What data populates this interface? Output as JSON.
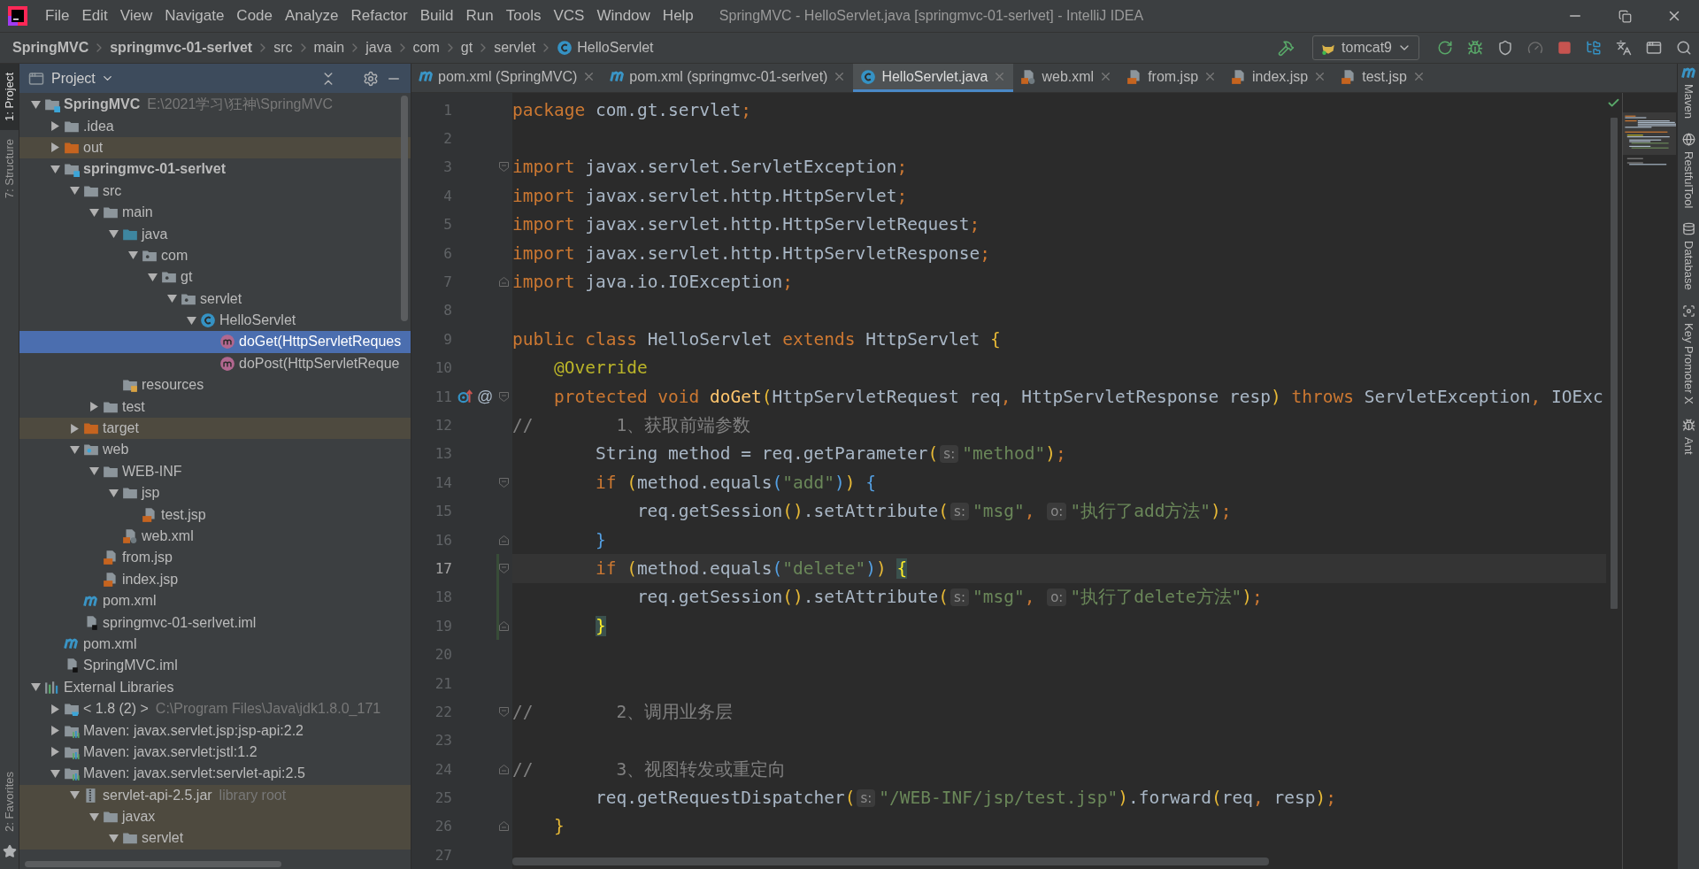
{
  "window": {
    "title": "SpringMVC - HelloServlet.java [springmvc-01-serlvet] - IntelliJ IDEA"
  },
  "menu": [
    "File",
    "Edit",
    "View",
    "Navigate",
    "Code",
    "Analyze",
    "Refactor",
    "Build",
    "Run",
    "Tools",
    "VCS",
    "Window",
    "Help"
  ],
  "breadcrumbs": [
    {
      "label": "SpringMVC",
      "bold": true,
      "kind": "plain"
    },
    {
      "label": "springmvc-01-serlvet",
      "bold": true,
      "kind": "plain"
    },
    {
      "label": "src",
      "bold": false,
      "kind": "plain"
    },
    {
      "label": "main",
      "bold": false,
      "kind": "plain"
    },
    {
      "label": "java",
      "bold": false,
      "kind": "plain"
    },
    {
      "label": "com",
      "bold": false,
      "kind": "plain"
    },
    {
      "label": "gt",
      "bold": false,
      "kind": "plain"
    },
    {
      "label": "servlet",
      "bold": false,
      "kind": "plain"
    },
    {
      "label": "HelloServlet",
      "bold": false,
      "kind": "class"
    }
  ],
  "run_config": {
    "label": "tomcat9"
  },
  "left_tool_tabs": {
    "top": [
      {
        "label": "1: Project",
        "selected": true
      },
      {
        "label": "7: Structure",
        "selected": false
      }
    ],
    "bottom": [
      {
        "label": "2: Favorites",
        "selected": false
      }
    ]
  },
  "project": {
    "title": "Project",
    "tree": [
      {
        "label": "SpringMVC",
        "detail": "E:\\2021学习\\狂神\\SpringMVC",
        "kind": "module",
        "bold": true,
        "expanded": true,
        "selected": false,
        "excluded": false,
        "children": [
          {
            "label": ".idea",
            "kind": "folder",
            "bold": false,
            "expanded": false,
            "selected": false,
            "excluded": false
          },
          {
            "label": "out",
            "kind": "excluded",
            "bold": false,
            "expanded": false,
            "selected": false,
            "excluded": true
          },
          {
            "label": "springmvc-01-serlvet",
            "kind": "module",
            "bold": true,
            "expanded": true,
            "selected": false,
            "excluded": false,
            "children": [
              {
                "label": "src",
                "kind": "folder",
                "bold": false,
                "expanded": true,
                "selected": false,
                "excluded": false,
                "children": [
                  {
                    "label": "main",
                    "kind": "folder",
                    "bold": false,
                    "expanded": true,
                    "selected": false,
                    "excluded": false,
                    "children": [
                      {
                        "label": "java",
                        "kind": "source",
                        "bold": false,
                        "expanded": true,
                        "selected": false,
                        "excluded": false,
                        "children": [
                          {
                            "label": "com",
                            "kind": "package",
                            "bold": false,
                            "expanded": true,
                            "selected": false,
                            "excluded": false,
                            "children": [
                              {
                                "label": "gt",
                                "kind": "package",
                                "bold": false,
                                "expanded": true,
                                "selected": false,
                                "excluded": false,
                                "children": [
                                  {
                                    "label": "servlet",
                                    "kind": "package",
                                    "bold": false,
                                    "expanded": true,
                                    "selected": false,
                                    "excluded": false,
                                    "children": [
                                      {
                                        "label": "HelloServlet",
                                        "kind": "class",
                                        "bold": false,
                                        "expanded": true,
                                        "selected": false,
                                        "excluded": false,
                                        "children": [
                                          {
                                            "label": "doGet(HttpServletReques",
                                            "kind": "method",
                                            "bold": false,
                                            "selected": true,
                                            "excluded": false
                                          },
                                          {
                                            "label": "doPost(HttpServletReque",
                                            "kind": "method",
                                            "bold": false,
                                            "selected": false,
                                            "excluded": false
                                          }
                                        ]
                                      }
                                    ]
                                  }
                                ]
                              }
                            ]
                          }
                        ]
                      },
                      {
                        "label": "resources",
                        "kind": "resources",
                        "bold": false,
                        "selected": false,
                        "excluded": false
                      }
                    ]
                  },
                  {
                    "label": "test",
                    "kind": "folder",
                    "bold": false,
                    "expanded": false,
                    "selected": false,
                    "excluded": false
                  }
                ]
              },
              {
                "label": "target",
                "kind": "excluded",
                "bold": false,
                "expanded": false,
                "selected": false,
                "excluded": true
              },
              {
                "label": "web",
                "kind": "web",
                "bold": false,
                "expanded": true,
                "selected": false,
                "excluded": false,
                "children": [
                  {
                    "label": "WEB-INF",
                    "kind": "folder",
                    "bold": false,
                    "expanded": true,
                    "selected": false,
                    "excluded": false,
                    "children": [
                      {
                        "label": "jsp",
                        "kind": "folder",
                        "bold": false,
                        "expanded": true,
                        "selected": false,
                        "excluded": false,
                        "children": [
                          {
                            "label": "test.jsp",
                            "kind": "jsp",
                            "bold": false,
                            "selected": false,
                            "excluded": false
                          }
                        ]
                      },
                      {
                        "label": "web.xml",
                        "kind": "xml",
                        "bold": false,
                        "selected": false,
                        "excluded": false
                      }
                    ]
                  },
                  {
                    "label": "from.jsp",
                    "kind": "jsp",
                    "bold": false,
                    "selected": false,
                    "excluded": false
                  },
                  {
                    "label": "index.jsp",
                    "kind": "jsp",
                    "bold": false,
                    "selected": false,
                    "excluded": false
                  }
                ]
              },
              {
                "label": "pom.xml",
                "kind": "maven",
                "bold": false,
                "selected": false,
                "excluded": false
              },
              {
                "label": "springmvc-01-serlvet.iml",
                "kind": "iml",
                "bold": false,
                "selected": false,
                "excluded": false
              }
            ]
          },
          {
            "label": "pom.xml",
            "kind": "maven",
            "bold": false,
            "selected": false,
            "excluded": false
          },
          {
            "label": "SpringMVC.iml",
            "kind": "iml",
            "bold": false,
            "selected": false,
            "excluded": false
          }
        ]
      },
      {
        "label": "External Libraries",
        "kind": "libraries",
        "bold": false,
        "expanded": true,
        "selected": false,
        "excluded": false,
        "children": [
          {
            "label": "< 1.8 (2) >",
            "detail": "C:\\Program Files\\Java\\jdk1.8.0_171",
            "kind": "jdk",
            "bold": false,
            "expanded": false,
            "selected": false,
            "excluded": false
          },
          {
            "label": "Maven: javax.servlet.jsp:jsp-api:2.2",
            "kind": "library",
            "bold": false,
            "expanded": false,
            "selected": false,
            "excluded": false
          },
          {
            "label": "Maven: javax.servlet:jstl:1.2",
            "kind": "library",
            "bold": false,
            "expanded": false,
            "selected": false,
            "excluded": false
          },
          {
            "label": "Maven: javax.servlet:servlet-api:2.5",
            "kind": "library",
            "bold": false,
            "expanded": true,
            "selected": false,
            "excluded": false,
            "children": [
              {
                "label": "servlet-api-2.5.jar",
                "detail": "library root",
                "kind": "jar",
                "bold": false,
                "expanded": true,
                "selected": false,
                "excluded": true,
                "children": [
                  {
                    "label": "javax",
                    "kind": "folder",
                    "bold": false,
                    "expanded": true,
                    "selected": false,
                    "excluded": true,
                    "children": [
                      {
                        "label": "servlet",
                        "kind": "folder",
                        "bold": false,
                        "expanded": true,
                        "selected": false,
                        "excluded": true
                      }
                    ]
                  }
                ]
              }
            ]
          }
        ]
      }
    ]
  },
  "editor_tabs": [
    {
      "label": "pom.xml (SpringMVC)",
      "kind": "maven",
      "selected": false
    },
    {
      "label": "pom.xml (springmvc-01-serlvet)",
      "kind": "maven",
      "selected": false
    },
    {
      "label": "HelloServlet.java",
      "kind": "class",
      "selected": true
    },
    {
      "label": "web.xml",
      "kind": "xml",
      "selected": false
    },
    {
      "label": "from.jsp",
      "kind": "jsp",
      "selected": false
    },
    {
      "label": "index.jsp",
      "kind": "jsp",
      "selected": false
    },
    {
      "label": "test.jsp",
      "kind": "jsp",
      "selected": false
    }
  ],
  "code": [
    {
      "number": "1",
      "current": false,
      "tokens": [
        {
          "kind": "kw",
          "text": "package"
        },
        {
          "kind": "tx",
          "text": " com.gt.servlet"
        },
        {
          "kind": "kw",
          "text": ";"
        }
      ]
    },
    {
      "number": "2",
      "current": false
    },
    {
      "number": "3",
      "current": false,
      "fold": {
        "kind": "start"
      },
      "tokens": [
        {
          "kind": "kw",
          "text": "import"
        },
        {
          "kind": "tx",
          "text": " javax.servlet.ServletException"
        },
        {
          "kind": "kw",
          "text": ";"
        }
      ]
    },
    {
      "number": "4",
      "current": false,
      "tokens": [
        {
          "kind": "kw",
          "text": "import"
        },
        {
          "kind": "tx",
          "text": " javax.servlet.http.HttpServlet"
        },
        {
          "kind": "kw",
          "text": ";"
        }
      ]
    },
    {
      "number": "5",
      "current": false,
      "tokens": [
        {
          "kind": "kw",
          "text": "import"
        },
        {
          "kind": "tx",
          "text": " javax.servlet.http.HttpServletRequest"
        },
        {
          "kind": "kw",
          "text": ";"
        }
      ]
    },
    {
      "number": "6",
      "current": false,
      "tokens": [
        {
          "kind": "kw",
          "text": "import"
        },
        {
          "kind": "tx",
          "text": " javax.servlet.http.HttpServletResponse"
        },
        {
          "kind": "kw",
          "text": ";"
        }
      ]
    },
    {
      "number": "7",
      "current": false,
      "fold": {
        "kind": "end"
      },
      "tokens": [
        {
          "kind": "kw",
          "text": "import"
        },
        {
          "kind": "tx",
          "text": " java.io.IOException"
        },
        {
          "kind": "kw",
          "text": ";"
        }
      ]
    },
    {
      "number": "8",
      "current": false
    },
    {
      "number": "9",
      "current": false,
      "tokens": [
        {
          "kind": "kw",
          "text": "public class"
        },
        {
          "kind": "tx",
          "text": " HelloServlet "
        },
        {
          "kind": "kw",
          "text": "extends"
        },
        {
          "kind": "tx",
          "text": " HttpServlet "
        },
        {
          "kind": "br1",
          "text": "{"
        }
      ]
    },
    {
      "number": "10",
      "current": false,
      "tokens": [
        {
          "kind": "an",
          "text": "    @Override"
        }
      ]
    },
    {
      "number": "11",
      "current": false,
      "override": true,
      "annotation_mark": "@",
      "fold": {
        "kind": "start"
      },
      "tokens": [
        {
          "kind": "kw",
          "text": "    protected void "
        },
        {
          "kind": "fn",
          "text": "doGet"
        },
        {
          "kind": "br1",
          "text": "("
        },
        {
          "kind": "tx",
          "text": "HttpServletRequest req"
        },
        {
          "kind": "kw",
          "text": ", "
        },
        {
          "kind": "tx",
          "text": "HttpServletResponse resp"
        },
        {
          "kind": "br1",
          "text": ")"
        },
        {
          "kind": "kw",
          "text": " throws "
        },
        {
          "kind": "tx",
          "text": "ServletException"
        },
        {
          "kind": "kw",
          "text": ", "
        },
        {
          "kind": "tx",
          "text": "IOExc"
        }
      ]
    },
    {
      "number": "12",
      "current": false,
      "tokens": [
        {
          "kind": "cm",
          "text": "//        1、获取前端参数"
        }
      ]
    },
    {
      "number": "13",
      "current": false,
      "tokens": [
        {
          "kind": "tx",
          "text": "        String method = req.getParameter"
        },
        {
          "kind": "br1",
          "text": "("
        },
        {
          "kind": "hint",
          "text": "s:"
        },
        {
          "kind": "str",
          "text": "\"method\""
        },
        {
          "kind": "br1",
          "text": ")"
        },
        {
          "kind": "kw",
          "text": ";"
        }
      ]
    },
    {
      "number": "14",
      "current": false,
      "fold": {
        "kind": "start"
      },
      "tokens": [
        {
          "kind": "kw",
          "text": "        if "
        },
        {
          "kind": "br1",
          "text": "("
        },
        {
          "kind": "tx",
          "text": "method.equals"
        },
        {
          "kind": "br2",
          "text": "("
        },
        {
          "kind": "str",
          "text": "\"add\""
        },
        {
          "kind": "br2",
          "text": ")"
        },
        {
          "kind": "br1",
          "text": ")"
        },
        {
          "kind": "br2",
          "text": " {"
        }
      ]
    },
    {
      "number": "15",
      "current": false,
      "tokens": [
        {
          "kind": "tx",
          "text": "            req.getSession"
        },
        {
          "kind": "br1",
          "text": "()"
        },
        {
          "kind": "tx",
          "text": ".setAttribute"
        },
        {
          "kind": "br1",
          "text": "("
        },
        {
          "kind": "hint",
          "text": "s:"
        },
        {
          "kind": "str",
          "text": "\"msg\""
        },
        {
          "kind": "kw",
          "text": ", "
        },
        {
          "kind": "hint",
          "text": "o:"
        },
        {
          "kind": "str",
          "text": "\"执行了add方法\""
        },
        {
          "kind": "br1",
          "text": ")"
        },
        {
          "kind": "kw",
          "text": ";"
        }
      ]
    },
    {
      "number": "16",
      "current": false,
      "fold": {
        "kind": "end"
      },
      "tokens": [
        {
          "kind": "br2",
          "text": "        }"
        }
      ]
    },
    {
      "number": "17",
      "current": true,
      "changed": true,
      "fold": {
        "kind": "start"
      },
      "tokens": [
        {
          "kind": "kw",
          "text": "        if "
        },
        {
          "kind": "br1",
          "text": "("
        },
        {
          "kind": "tx",
          "text": "method.equals"
        },
        {
          "kind": "br2",
          "text": "("
        },
        {
          "kind": "str",
          "text": "\"delete\""
        },
        {
          "kind": "br2",
          "text": ")"
        },
        {
          "kind": "br1",
          "text": ")"
        },
        {
          "kind": "bm",
          "text": " {"
        }
      ]
    },
    {
      "number": "18",
      "current": false,
      "changed": true,
      "tokens": [
        {
          "kind": "tx",
          "text": "            req.getSession"
        },
        {
          "kind": "br1",
          "text": "()"
        },
        {
          "kind": "tx",
          "text": ".setAttribute"
        },
        {
          "kind": "br1",
          "text": "("
        },
        {
          "kind": "hint",
          "text": "s:"
        },
        {
          "kind": "str",
          "text": "\"msg\""
        },
        {
          "kind": "kw",
          "text": ", "
        },
        {
          "kind": "hint",
          "text": "o:"
        },
        {
          "kind": "str",
          "text": "\"执行了delete方法\""
        },
        {
          "kind": "br1",
          "text": ")"
        },
        {
          "kind": "kw",
          "text": ";"
        }
      ]
    },
    {
      "number": "19",
      "current": false,
      "changed": true,
      "fold": {
        "kind": "end"
      },
      "tokens": [
        {
          "kind": "bm",
          "text": "        }"
        }
      ]
    },
    {
      "number": "20",
      "current": false
    },
    {
      "number": "21",
      "current": false
    },
    {
      "number": "22",
      "current": false,
      "fold": {
        "kind": "start"
      },
      "tokens": [
        {
          "kind": "cm",
          "text": "//        2、调用业务层"
        }
      ]
    },
    {
      "number": "23",
      "current": false
    },
    {
      "number": "24",
      "current": false,
      "fold": {
        "kind": "end"
      },
      "tokens": [
        {
          "kind": "cm",
          "text": "//        3、视图转发或重定向"
        }
      ]
    },
    {
      "number": "25",
      "current": false,
      "tokens": [
        {
          "kind": "tx",
          "text": "        req.getRequestDispatcher"
        },
        {
          "kind": "br1",
          "text": "("
        },
        {
          "kind": "hint",
          "text": "s:"
        },
        {
          "kind": "str",
          "text": "\"/WEB-INF/jsp/test.jsp\""
        },
        {
          "kind": "br1",
          "text": ")"
        },
        {
          "kind": "tx",
          "text": ".forward"
        },
        {
          "kind": "br1",
          "text": "("
        },
        {
          "kind": "tx",
          "text": "req"
        },
        {
          "kind": "kw",
          "text": ", "
        },
        {
          "kind": "tx",
          "text": "resp"
        },
        {
          "kind": "br1",
          "text": ")"
        },
        {
          "kind": "kw",
          "text": ";"
        }
      ]
    },
    {
      "number": "26",
      "current": false,
      "fold": {
        "kind": "end"
      },
      "tokens": [
        {
          "kind": "br1",
          "text": "    }"
        }
      ]
    },
    {
      "number": "27",
      "current": false
    }
  ],
  "right_tool_tabs": [
    {
      "label": "Maven",
      "kind": "maven"
    },
    {
      "label": "RestfulTool",
      "kind": "globe"
    },
    {
      "label": "Database",
      "kind": "database"
    },
    {
      "label": "Key Promoter X",
      "kind": "key"
    },
    {
      "label": "Ant",
      "kind": "ant"
    }
  ]
}
